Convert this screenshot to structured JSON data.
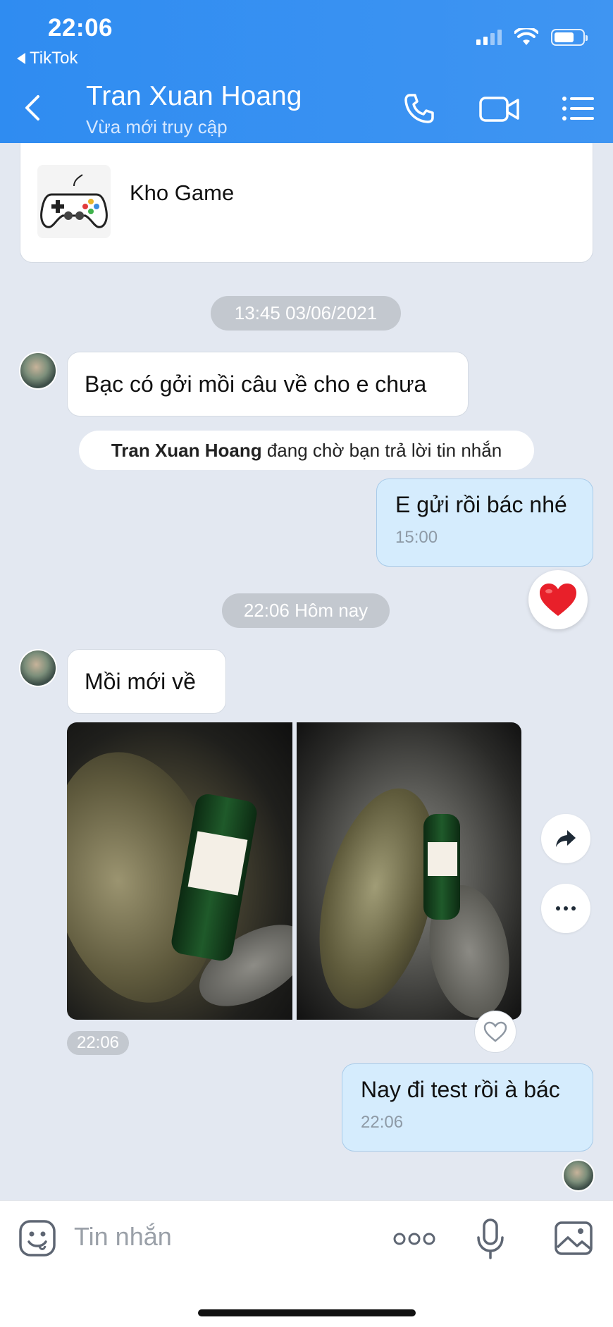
{
  "status_bar": {
    "time": "22:06",
    "back_app": "TikTok"
  },
  "header": {
    "contact_name": "Tran Xuan Hoang",
    "contact_status": "Vừa mới truy cập"
  },
  "card": {
    "label": "Kho Game"
  },
  "messages": {
    "time_divider_1": "13:45 03/06/2021",
    "in_1": "Bạc có gởi mồi câu về cho e chưa",
    "notice_name": "Tran Xuan Hoang",
    "notice_text": " đang chờ bạn trả lời tin nhắn",
    "out_1": "E gửi rồi bác nhé",
    "out_1_time": "15:00",
    "time_divider_2": "22:06 Hôm nay",
    "in_2": "Mồi mới về",
    "photo_time": "22:06",
    "out_2": "Nay đi test rồi à bác",
    "out_2_time": "22:06"
  },
  "composer": {
    "placeholder": "Tin nhắn"
  },
  "colors": {
    "header_blue": "#3a92f2",
    "chat_bg": "#e3e8f1",
    "outgoing_bubble": "#d5ecfd",
    "heart": "#e8202a"
  }
}
